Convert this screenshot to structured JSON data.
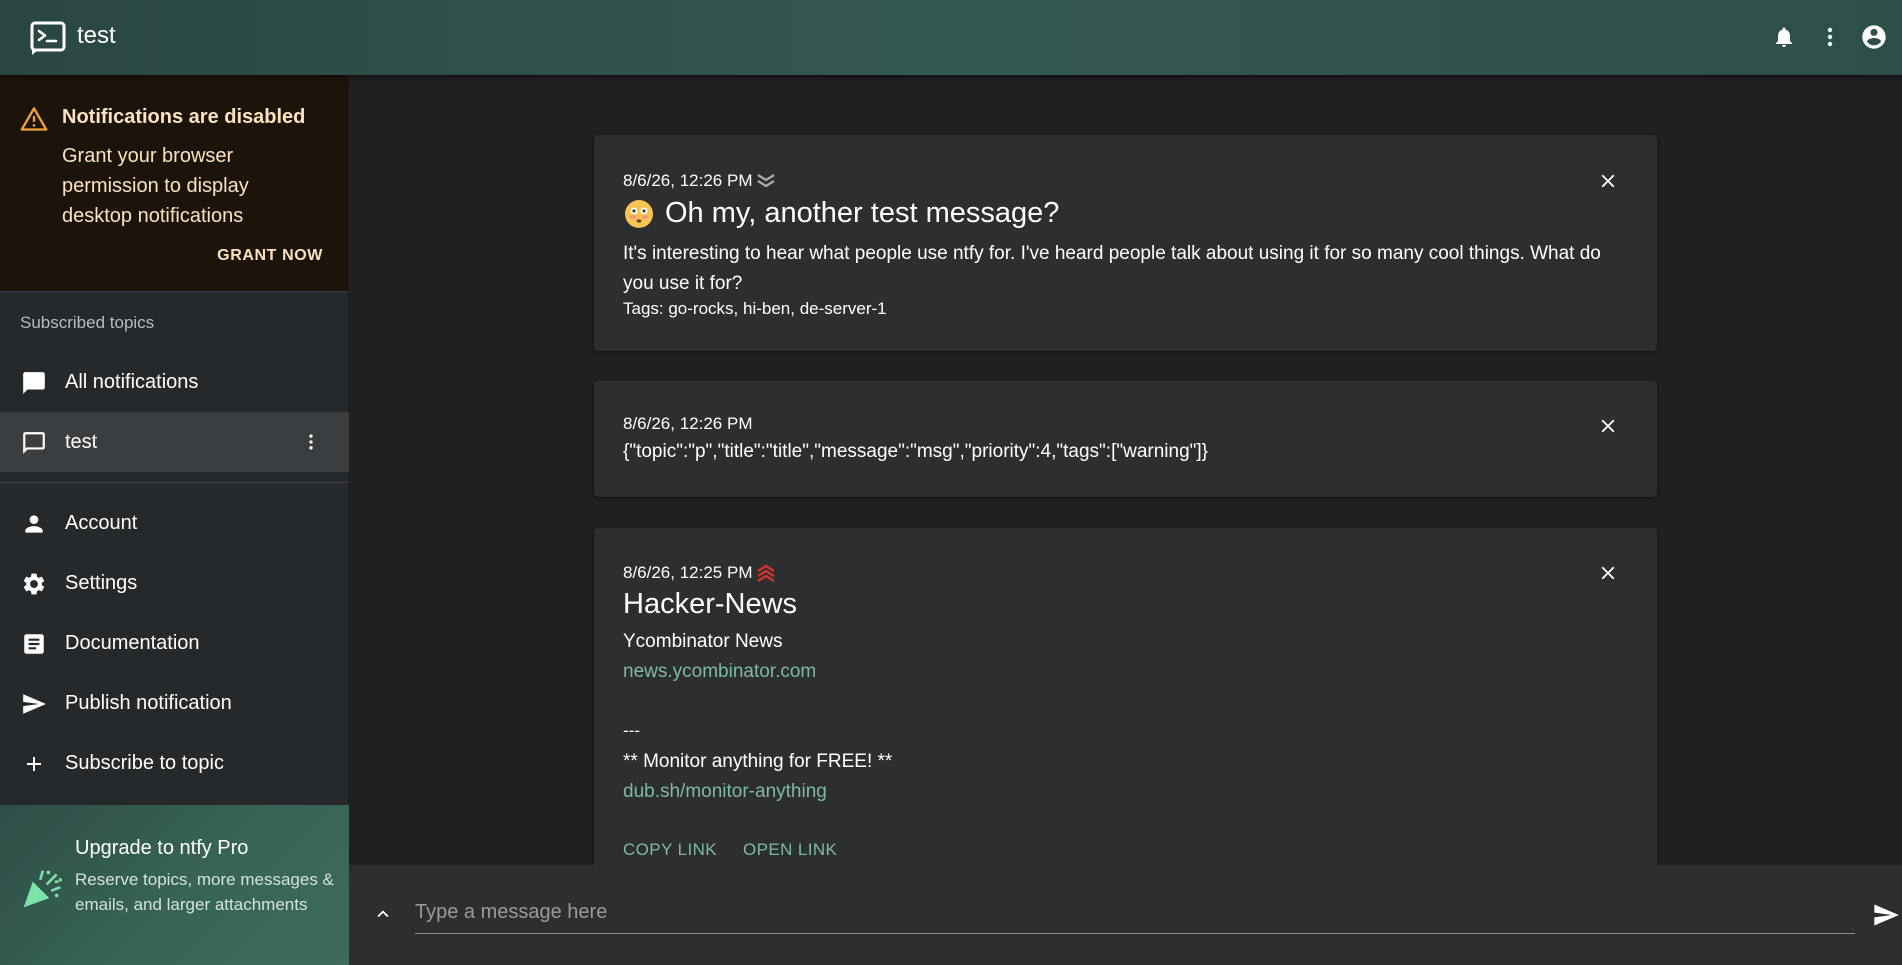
{
  "app": {
    "title": "test"
  },
  "alert": {
    "title": "Notifications are disabled",
    "body": "Grant your browser permission to display desktop notifications",
    "button": "GRANT NOW"
  },
  "sidebar": {
    "section_label": "Subscribed topics",
    "topics": [
      {
        "label": "All notifications",
        "icon": "chat-bubble-icon"
      },
      {
        "label": "test",
        "icon": "chat-outline-icon"
      }
    ],
    "nav": [
      {
        "label": "Account",
        "icon": "person-icon"
      },
      {
        "label": "Settings",
        "icon": "gear-icon"
      },
      {
        "label": "Documentation",
        "icon": "article-icon"
      },
      {
        "label": "Publish notification",
        "icon": "send-icon"
      },
      {
        "label": "Subscribe to topic",
        "icon": "plus-icon"
      }
    ],
    "upgrade": {
      "title": "Upgrade to ntfy Pro",
      "body": "Reserve topics, more messages & emails, and larger attachments"
    }
  },
  "notifications": [
    {
      "timestamp": "8/6/26, 12:26 PM",
      "priority": "low",
      "title": "Oh my, another test message?",
      "message": "It's interesting to hear what people use ntfy for. I've heard people talk about using it for so many cool things. What do you use it for?",
      "tags": "Tags: go-rocks, hi-ben, de-server-1"
    },
    {
      "timestamp": "8/6/26, 12:26 PM",
      "message": "{\"topic\":\"p\",\"title\":\"title\",\"message\":\"msg\",\"priority\":4,\"tags\":[\"warning\"]}"
    },
    {
      "timestamp": "8/6/26, 12:25 PM",
      "priority": "max",
      "title": "Hacker-News",
      "line1": "Ycombinator News",
      "link1": "news.ycombinator.com",
      "line2": "---",
      "line3": "** Monitor anything for FREE! **",
      "link2": "dub.sh/monitor-anything",
      "actions": [
        "COPY LINK",
        "OPEN LINK"
      ]
    }
  ],
  "composer": {
    "placeholder": "Type a message here"
  },
  "colors": {
    "accent": "#7eb8a6",
    "alert_text": "#fbe3bf",
    "warn_icon": "#f0a13a",
    "priority_max": "#d9342b",
    "priority_low": "#a8a8a8"
  }
}
